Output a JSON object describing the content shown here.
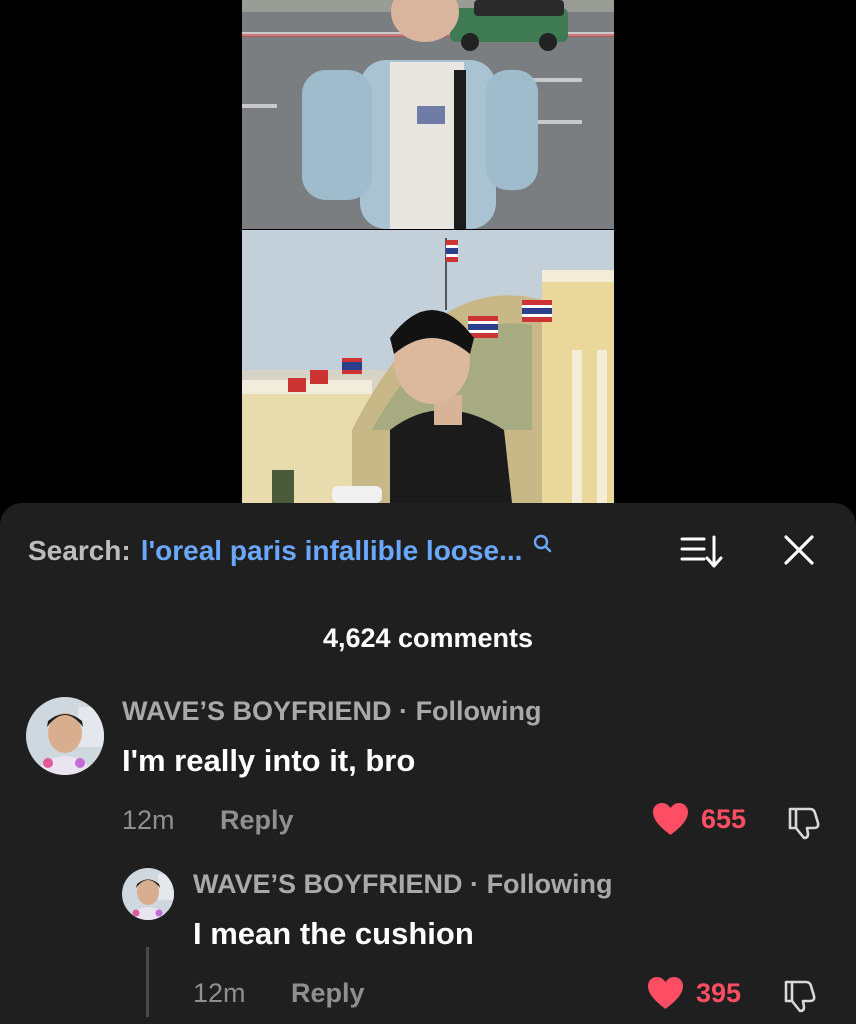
{
  "search": {
    "label": "Search:",
    "query": "l'oreal paris infallible loose..."
  },
  "comments_count": "4,624 comments",
  "comments": [
    {
      "author": "WAVE’S BOYFRIEND",
      "separator": "·",
      "relation": "Following",
      "text": "I'm really into it, bro",
      "time": "12m",
      "reply_label": "Reply",
      "likes": "655"
    },
    {
      "author": "WAVE’S BOYFRIEND",
      "separator": "·",
      "relation": "Following",
      "text": "I mean the cushion",
      "time": "12m",
      "reply_label": "Reply",
      "likes": "395"
    }
  ],
  "colors": {
    "sheet_bg": "#1f1f1f",
    "search_query": "#6aa8ff",
    "like_red": "#ff4d63",
    "muted_text": "#8f8f8f"
  },
  "icons": [
    "search-icon",
    "sort-icon",
    "close-icon",
    "heart-icon",
    "dislike-icon"
  ]
}
